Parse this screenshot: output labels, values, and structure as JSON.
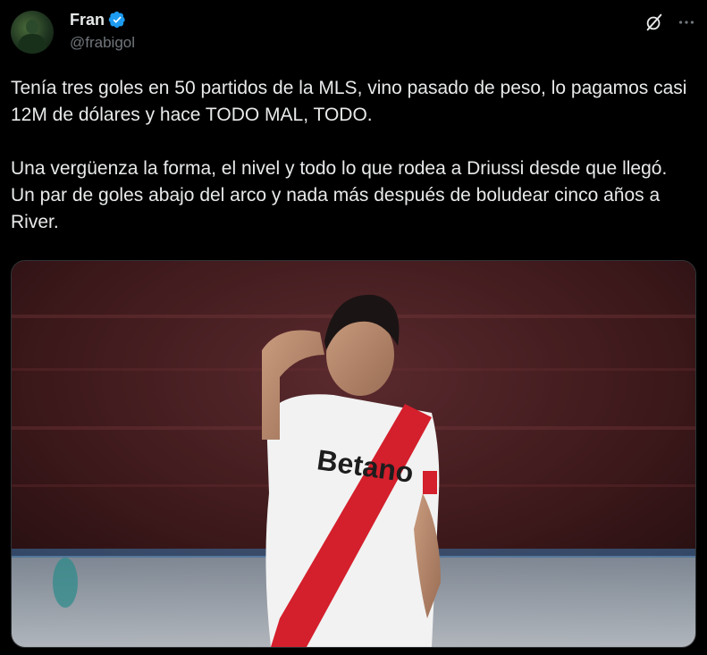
{
  "author": {
    "display_name": "Fran",
    "handle": "@frabigol",
    "verified": true,
    "avatar_icon": "avatar-photo"
  },
  "actions": {
    "grok_icon": "grok-icon",
    "more_icon": "more-icon"
  },
  "tweet": {
    "paragraphs": [
      "Tenía tres goles en 50 partidos de la MLS, vino pasado de peso, lo pagamos casi 12M de dólares y hace TODO MAL, TODO.",
      "Una vergüenza la forma, el nivel y todo lo que rodea a Driussi desde que llegó. Un par de goles abajo del arco y nada más después de boludear cinco años a River."
    ]
  },
  "media": {
    "shirt_sponsor": "Betano"
  },
  "colors": {
    "background": "#000000",
    "text": "#e7e9ea",
    "secondary_text": "#71767b",
    "verified_blue": "#1d9bf0",
    "border": "#2f3336",
    "jersey_red": "#d41f2c"
  }
}
